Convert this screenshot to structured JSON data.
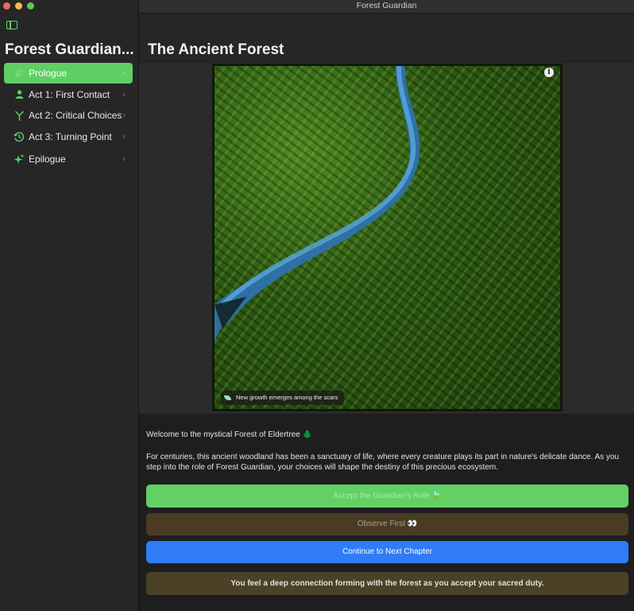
{
  "window": {
    "title": "Forest Guardian",
    "traffic_colors": [
      "#ed6a5e",
      "#f5bf4f",
      "#61c554"
    ]
  },
  "sidebar": {
    "title": "Forest Guardian...",
    "items": [
      {
        "label": "Prologue",
        "icon": "leaf-icon",
        "active": true
      },
      {
        "label": "Act 1: First Contact",
        "icon": "person-icon",
        "active": false
      },
      {
        "label": "Act 2: Critical Choices",
        "icon": "branch-icon",
        "active": false
      },
      {
        "label": "Act 3: Turning Point",
        "icon": "history-clock-icon",
        "active": false
      },
      {
        "label": "Epilogue",
        "icon": "sparkles-icon",
        "active": false
      }
    ]
  },
  "main": {
    "title": "The Ancient Forest",
    "image_caption": "New growth emerges among the scars",
    "welcome_text": "Welcome to the mystical Forest of Eldertree 🌲",
    "body_text": "For centuries, this ancient woodland has been a sanctuary of life, where every creature plays its part in nature's delicate dance. As you step into the role of Forest Guardian, your choices will shape the destiny of this precious ecosystem.",
    "accept_button": "Accept the Guardian's Role 🍃",
    "observe_button": "Observe First 👀",
    "next_button": "Continue to Next Chapter",
    "status_message": "You feel a deep connection forming with the forest as you accept your sacred duty."
  },
  "colors": {
    "accent_green": "#5fce63",
    "blue": "#2f7cf6",
    "brown": "#4a3b24",
    "notice": "#4a4127",
    "river": "#3a8fd0"
  }
}
